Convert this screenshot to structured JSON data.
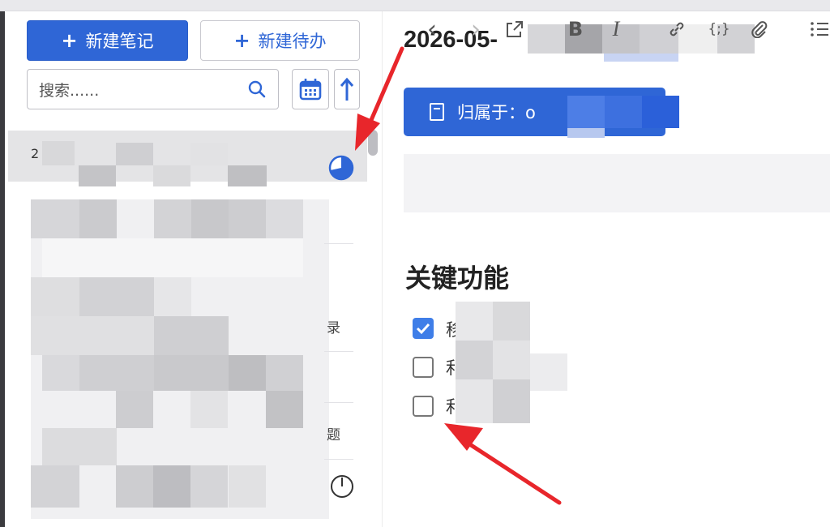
{
  "sidebar": {
    "new_note_label": "新建笔记",
    "new_todo_label": "新建待办",
    "search_placeholder": "搜索......",
    "first_row_prefix": "2",
    "fragments": [
      "录",
      "题"
    ]
  },
  "note": {
    "title": "2026-05-",
    "belongs_to": "归属于：o",
    "heading": "关键功能",
    "tasks": [
      {
        "label": "移",
        "checked": true
      },
      {
        "label": "利",
        "checked": false
      },
      {
        "label": "利",
        "checked": false
      }
    ]
  },
  "toolbar": {
    "back": "‹",
    "forward": "›",
    "bold": "B",
    "italic": "I",
    "code": "{;}"
  },
  "colors": {
    "primary": "#2f66d6",
    "checkbox": "#3f7ee8",
    "annotation": "#e8262b"
  }
}
